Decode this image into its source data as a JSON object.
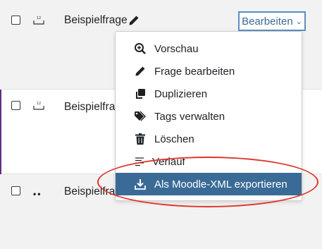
{
  "questions": [
    {
      "name": "Beispielfrage"
    },
    {
      "name": "Beispielfrage"
    },
    {
      "name": "Beispielfrage"
    }
  ],
  "row3_type_glyph": "••",
  "actions": {
    "button_label": "Bearbeiten",
    "chevron": "⌄",
    "menu": [
      {
        "label": "Vorschau",
        "icon": "zoom-in-icon"
      },
      {
        "label": "Frage bearbeiten",
        "icon": "pencil-icon"
      },
      {
        "label": "Duplizieren",
        "icon": "copy-icon"
      },
      {
        "label": "Tags verwalten",
        "icon": "tags-icon"
      },
      {
        "label": "Löschen",
        "icon": "trash-icon"
      },
      {
        "label": "Verlauf",
        "icon": "history-icon"
      },
      {
        "label": "Als Moodle-XML exportieren",
        "icon": "download-icon",
        "active": true
      }
    ]
  },
  "colors": {
    "active_item_bg": "#3a6b96",
    "button_border": "#5b8fbf",
    "annotation_ellipse": "#e0352b"
  }
}
